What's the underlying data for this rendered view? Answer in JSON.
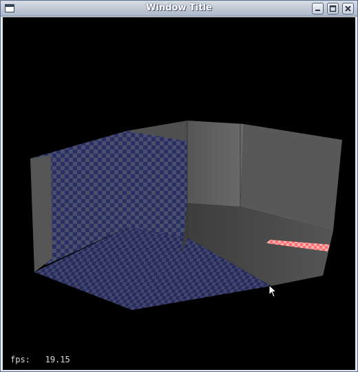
{
  "window": {
    "title": "Window Title"
  },
  "titlebar_buttons": [
    {
      "name": "minimize",
      "icon": "minimize-icon"
    },
    {
      "name": "maximize",
      "icon": "maximize-icon"
    },
    {
      "name": "close",
      "icon": "close-icon"
    }
  ],
  "hud": {
    "fps_label": "fps:",
    "fps_value": "19.15"
  },
  "colors": {
    "title_gradient_top": "#d8dde6",
    "title_gradient_bottom": "#aeb8c8",
    "viewport_bg": "#000000",
    "checker_dark": "#2a2f62",
    "checker_light": "#4a4f70",
    "wall_gray": "#555555",
    "floor_gray": "#444444",
    "red_checker": "#ff7f7f"
  }
}
